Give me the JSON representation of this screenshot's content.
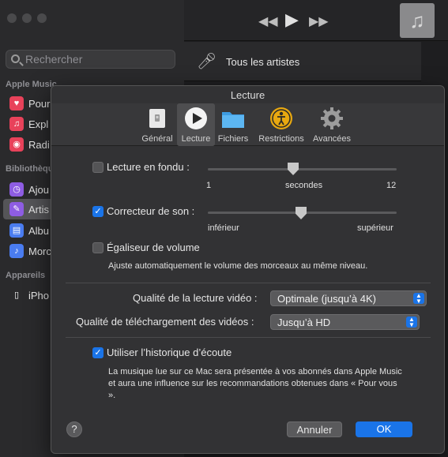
{
  "background": {
    "search_placeholder": "Rechercher",
    "sections": {
      "apple_music": "Apple Music",
      "library": "Bibliothèque",
      "devices": "Appareils"
    },
    "sidebar_items": [
      {
        "label": "Pour",
        "color": "#e8425a",
        "glyph": "♥"
      },
      {
        "label": "Expl",
        "color": "#e8425a",
        "glyph": "♫"
      },
      {
        "label": "Radi",
        "color": "#e8425a",
        "glyph": "◉"
      },
      {
        "label": "Ajou",
        "color": "#8e5de3",
        "glyph": "◷"
      },
      {
        "label": "Artis",
        "color": "#8e5de3",
        "glyph": "✎"
      },
      {
        "label": "Albu",
        "color": "#4a7cf0",
        "glyph": "▤"
      },
      {
        "label": "Morc",
        "color": "#4a7cf0",
        "glyph": "♪"
      },
      {
        "label": "iPho",
        "color": "transparent",
        "glyph": "▯"
      }
    ],
    "artists_row_label": "Tous les artistes"
  },
  "dialog": {
    "title": "Lecture",
    "tabs": [
      {
        "label": "Général",
        "icon": "general-icon"
      },
      {
        "label": "Lecture",
        "icon": "play-icon",
        "selected": true
      },
      {
        "label": "Fichiers",
        "icon": "folder-icon"
      },
      {
        "label": "Restrictions",
        "icon": "restrictions-icon"
      },
      {
        "label": "Avancées",
        "icon": "gear-icon"
      }
    ],
    "crossfade": {
      "label": "Lecture en fondu :",
      "checked": false,
      "min_label": "1",
      "unit_label": "secondes",
      "max_label": "12"
    },
    "sound_enhancer": {
      "label": "Correcteur de son :",
      "checked": true,
      "min_label": "inférieur",
      "max_label": "supérieur"
    },
    "sound_check": {
      "label": "Égaliseur de volume",
      "checked": false,
      "description": "Ajuste automatiquement le volume des morceaux au même niveau."
    },
    "video_quality": {
      "label": "Qualité de la lecture vidéo :",
      "value": "Optimale (jusqu’à 4K)"
    },
    "download_quality": {
      "label": "Qualité de téléchargement des vidéos :",
      "value": "Jusqu’à HD"
    },
    "listening_history": {
      "label": "Utiliser l’historique d’écoute",
      "checked": true,
      "description": "La musique lue sur ce Mac sera présentée à vos abonnés dans Apple Music et aura une influence sur les recommandations obtenues dans « Pour vous »."
    },
    "buttons": {
      "help": "?",
      "cancel": "Annuler",
      "ok": "OK"
    }
  }
}
